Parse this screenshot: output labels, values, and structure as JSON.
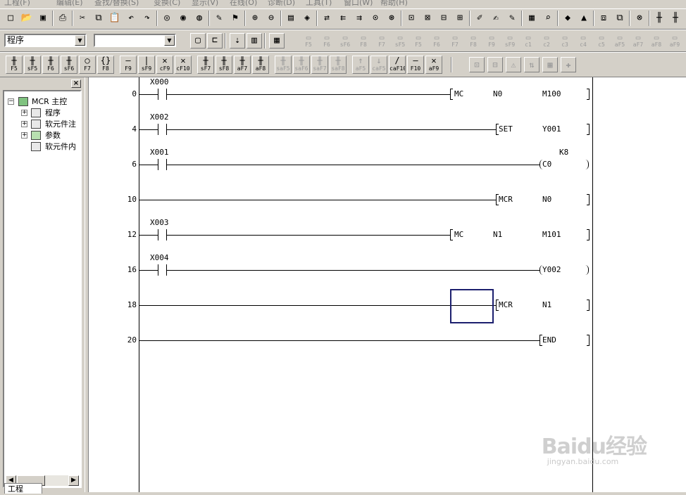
{
  "menu": [
    "工程(F)",
    "编辑(E)",
    "查找/替换(S)",
    "变换(C)",
    "显示(V)",
    "在线(O)",
    "诊断(D)",
    "工具(T)",
    "窗口(W)",
    "帮助(H)"
  ],
  "toolbar": {
    "data_type_select": "程序",
    "device_select": ""
  },
  "ladder_keys": [
    {
      "g": "╫",
      "k": "F5"
    },
    {
      "g": "╫",
      "k": "sF5"
    },
    {
      "g": "╫",
      "k": "F6"
    },
    {
      "g": "╫",
      "k": "sF6"
    },
    {
      "g": "○",
      "k": "F7"
    },
    {
      "g": "{}",
      "k": "F8"
    },
    {
      "g": "—",
      "k": "F9"
    },
    {
      "g": "|",
      "k": "sF9"
    },
    {
      "g": "✕",
      "k": "cF9"
    },
    {
      "g": "✕",
      "k": "cF10"
    },
    {
      "g": "╫",
      "k": "sF7"
    },
    {
      "g": "╫",
      "k": "sF8"
    },
    {
      "g": "╫",
      "k": "aF7"
    },
    {
      "g": "╫",
      "k": "aF8"
    },
    {
      "g": "╫",
      "k": "saF5"
    },
    {
      "g": "╫",
      "k": "saF6"
    },
    {
      "g": "╫",
      "k": "saF7"
    },
    {
      "g": "╫",
      "k": "saF8"
    },
    {
      "g": "↑",
      "k": "aF5"
    },
    {
      "g": "↓",
      "k": "caF5"
    },
    {
      "g": "/",
      "k": "caF10"
    },
    {
      "g": "—",
      "k": "F10"
    },
    {
      "g": "✕",
      "k": "aF9"
    }
  ],
  "sfc_keys": [
    "F5",
    "F6",
    "sF6",
    "F8",
    "F7",
    "sF5",
    "F5",
    "F6",
    "F7",
    "F8",
    "F9",
    "sF9",
    "c1",
    "c2",
    "c3",
    "c4",
    "c5",
    "aF5",
    "aF7",
    "aF8",
    "aF9"
  ],
  "project_tree": {
    "root": "MCR  主控",
    "items": [
      "程序",
      "软元件注",
      "参数",
      "软元件内"
    ],
    "tab": "工程"
  },
  "ladder": {
    "rungs": [
      {
        "step": "0",
        "contact": "X000",
        "instr": "MC",
        "op1": "N0",
        "op2": "M100",
        "kind": "box"
      },
      {
        "step": "4",
        "contact": "X002",
        "instr": "SET",
        "op1": "",
        "op2": "Y001",
        "kind": "box-short"
      },
      {
        "step": "6",
        "contact": "X001",
        "instr": "C0",
        "op1": "",
        "op2": "",
        "kind": "coil",
        "const": "K8"
      },
      {
        "step": "10",
        "contact": "",
        "instr": "MCR",
        "op1": "",
        "op2": "N0",
        "kind": "box-short"
      },
      {
        "step": "12",
        "contact": "X003",
        "instr": "MC",
        "op1": "N1",
        "op2": "M101",
        "kind": "box"
      },
      {
        "step": "16",
        "contact": "X004",
        "instr": "Y002",
        "op1": "",
        "op2": "",
        "kind": "coil"
      },
      {
        "step": "18",
        "contact": "",
        "instr": "MCR",
        "op1": "",
        "op2": "N1",
        "kind": "box-short"
      },
      {
        "step": "20",
        "contact": "",
        "instr": "END",
        "op1": "",
        "op2": "",
        "kind": "end"
      }
    ]
  },
  "watermark": {
    "logo": "Baidu经验",
    "sub": "jingyan.baidu.com"
  }
}
